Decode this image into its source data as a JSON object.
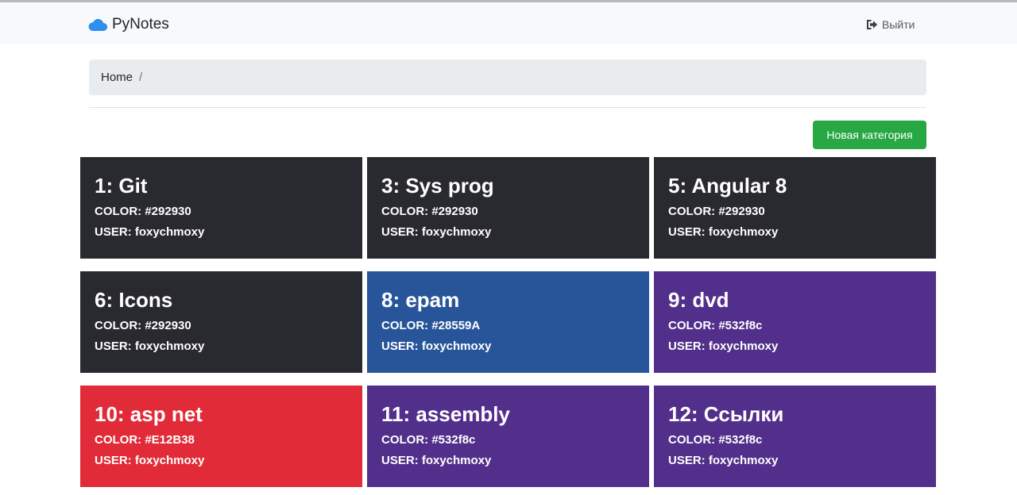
{
  "navbar": {
    "brand": "PyNotes",
    "brand_icon": "cloud-icon",
    "logout_label": "Выйти",
    "logout_icon": "sign-out-icon",
    "background": "#f8f9fa"
  },
  "breadcrumb": {
    "items": [
      "Home"
    ],
    "separator": "/"
  },
  "actions": {
    "new_category_label": "Новая категория",
    "new_category_color": "#28a745"
  },
  "colors": {
    "accent_brand": "#2e8ff0"
  },
  "categories": [
    {
      "title": "1: Git",
      "color_line": "COLOR: #292930",
      "user_line": "USER: foxychmoxy",
      "bg": "#292930"
    },
    {
      "title": "3: Sys prog",
      "color_line": "COLOR: #292930",
      "user_line": "USER: foxychmoxy",
      "bg": "#292930"
    },
    {
      "title": "5: Angular 8",
      "color_line": "COLOR: #292930",
      "user_line": "USER: foxychmoxy",
      "bg": "#292930"
    },
    {
      "title": "6: Icons",
      "color_line": "COLOR: #292930",
      "user_line": "USER: foxychmoxy",
      "bg": "#292930"
    },
    {
      "title": "8: epam",
      "color_line": "COLOR: #28559A",
      "user_line": "USER: foxychmoxy",
      "bg": "#28559A"
    },
    {
      "title": "9: dvd",
      "color_line": "COLOR: #532f8c",
      "user_line": "USER: foxychmoxy",
      "bg": "#532f8c"
    },
    {
      "title": "10: asp net",
      "color_line": "COLOR: #E12B38",
      "user_line": "USER: foxychmoxy",
      "bg": "#E12B38"
    },
    {
      "title": "11: assembly",
      "color_line": "COLOR: #532f8c",
      "user_line": "USER: foxychmoxy",
      "bg": "#532f8c"
    },
    {
      "title": "12: Ссылки",
      "color_line": "COLOR: #532f8c",
      "user_line": "USER: foxychmoxy",
      "bg": "#532f8c"
    }
  ]
}
